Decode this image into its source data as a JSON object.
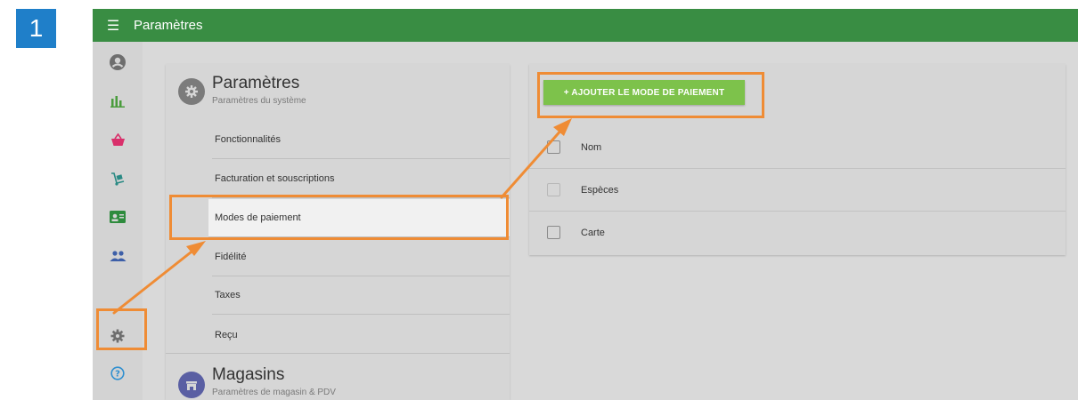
{
  "step_number": "1",
  "topbar": {
    "title": "Paramètres",
    "menu_icon": "hamburger-menu-icon"
  },
  "sidebar": {
    "items": [
      {
        "icon": "account-circle-icon",
        "color": "#6e6e6e"
      },
      {
        "icon": "bar-chart-icon",
        "color": "#4a9c3c"
      },
      {
        "icon": "shopping-basket-icon",
        "color": "#d9306b"
      },
      {
        "icon": "hand-truck-icon",
        "color": "#2a8a84"
      },
      {
        "icon": "contact-card-icon",
        "color": "#2e8b3d"
      },
      {
        "icon": "people-icon",
        "color": "#3d5fa8"
      },
      {
        "icon": "gear-icon",
        "color": "#6e6e6e",
        "active": true
      },
      {
        "icon": "help-circle-icon",
        "color": "#2f8fd0"
      }
    ]
  },
  "settings": {
    "title": "Paramètres",
    "subtitle": "Paramètres du système",
    "items": [
      {
        "label": "Fonctionnalités"
      },
      {
        "label": "Facturation et souscriptions"
      },
      {
        "label": "Modes de paiement",
        "active": true
      },
      {
        "label": "Fidélité"
      },
      {
        "label": "Taxes"
      },
      {
        "label": "Reçu"
      }
    ]
  },
  "stores": {
    "title": "Magasins",
    "subtitle": "Paramètres de magasin & PDV"
  },
  "payment_modes": {
    "add_button": "+ AJOUTER LE MODE DE PAIEMENT",
    "header": "Nom",
    "rows": [
      "Espèces",
      "Carte"
    ]
  },
  "colors": {
    "topbar": "#398d43",
    "button": "#7dc24b",
    "highlight": "#ef8c35",
    "step": "#1f7fc9"
  }
}
